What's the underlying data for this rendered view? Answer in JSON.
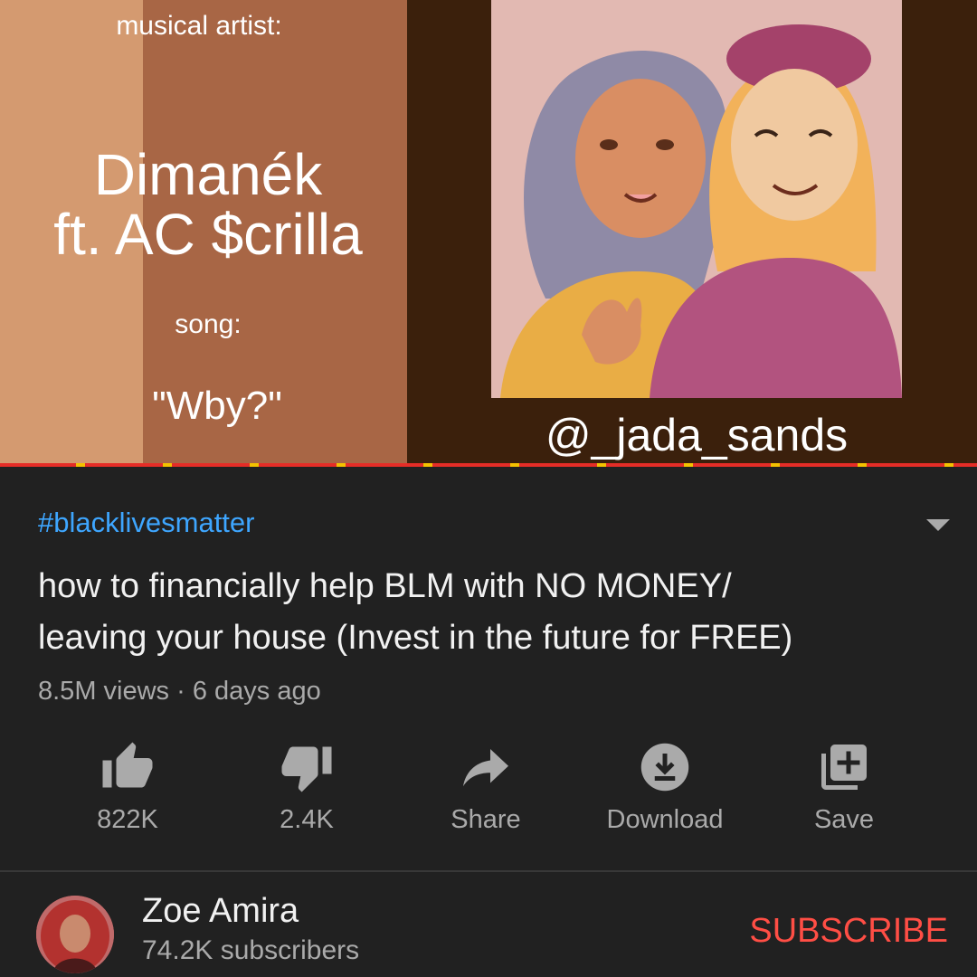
{
  "player": {
    "label_artist": "musical artist:",
    "artist_line1": "Dimanék",
    "artist_line2": "ft. AC $crilla",
    "label_song": "song:",
    "song": "\"Wby?\"",
    "art_credit": "@_jada_sands",
    "progress": 1.0,
    "colors": {
      "progress": "#e52d27",
      "marker": "#f4c200"
    }
  },
  "video": {
    "hashtag": "#blacklivesmatter",
    "title_line1": "how to financially help BLM with NO MONEY/",
    "title_line2": "leaving your house (Invest in the future for FREE)",
    "meta": "8.5M views · 6 days ago"
  },
  "actions": {
    "like": {
      "icon": "thumbs-up-icon",
      "label": "822K"
    },
    "dislike": {
      "icon": "thumbs-down-icon",
      "label": "2.4K"
    },
    "share": {
      "icon": "share-icon",
      "label": "Share"
    },
    "download": {
      "icon": "download-icon",
      "label": "Download"
    },
    "save": {
      "icon": "playlist-add-icon",
      "label": "Save"
    }
  },
  "channel": {
    "name": "Zoe Amira",
    "subscribers": "74.2K subscribers",
    "subscribe_label": "SUBSCRIBE",
    "subscribe_color": "#ff4e45"
  }
}
